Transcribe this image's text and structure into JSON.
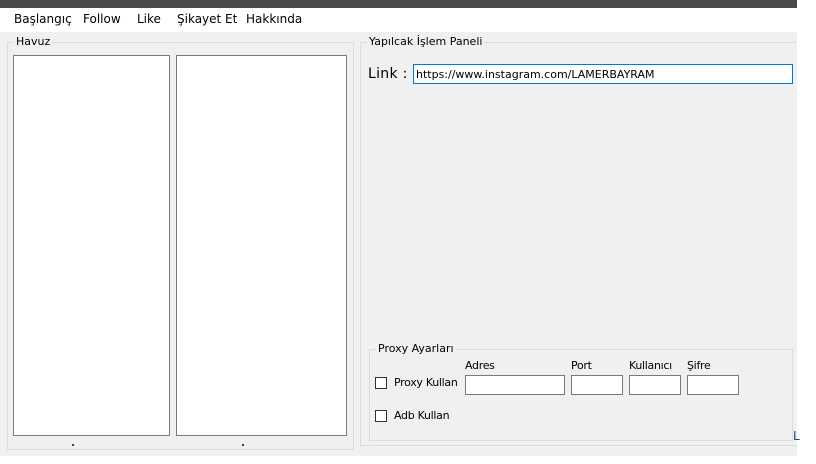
{
  "menu": [
    {
      "label": "Başlangıç"
    },
    {
      "label": "Follow"
    },
    {
      "label": "Like"
    },
    {
      "label": "Şikayet Et"
    },
    {
      "label": "Hakkında"
    }
  ],
  "havuz": {
    "title": "Havuz"
  },
  "panel": {
    "title": "Yapılcak İşlem Paneli",
    "link_label": "Link :",
    "link_value": "https://www.instagram.com/LAMERBAYRAM"
  },
  "proxy": {
    "title": "Proxy Ayarları",
    "labels": {
      "adres": "Adres",
      "port": "Port",
      "kullanici": "Kullanıcı",
      "sifre": "Şifre"
    },
    "use_proxy": {
      "label": "Proxy Kullan",
      "checked": false
    },
    "use_adb": {
      "label": "Adb Kullan",
      "checked": false
    },
    "values": {
      "adres": "",
      "port": "",
      "kullanici": "",
      "sifre": ""
    }
  },
  "edge_glyph": "L",
  "colors": {
    "window_bg": "#f0f0f0",
    "titlebar": "#4a4a4a",
    "focus_border": "#0078d7"
  }
}
